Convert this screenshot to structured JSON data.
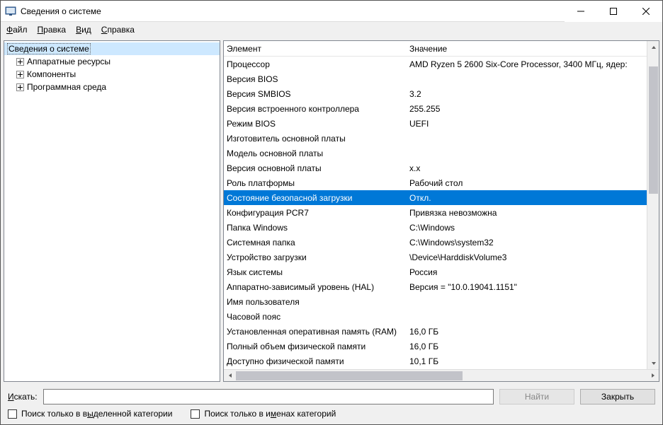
{
  "titlebar": {
    "title": "Сведения о системе"
  },
  "menubar": {
    "file": {
      "html": "<span class='ul'>Ф</span>айл"
    },
    "edit": {
      "html": "<span class='ul'>П</span>равка"
    },
    "view": {
      "html": "<span class='ul'>В</span>ид"
    },
    "help": {
      "html": "<span class='ul'>С</span>правка"
    }
  },
  "tree": {
    "root": "Сведения о системе",
    "items": [
      "Аппаратные ресурсы",
      "Компоненты",
      "Программная среда"
    ]
  },
  "detail": {
    "header_el": "Элемент",
    "header_val": "Значение",
    "rows": [
      {
        "el": "Процессор",
        "val": "AMD Ryzen 5 2600 Six-Core Processor, 3400 МГц, ядер:"
      },
      {
        "el": "Версия BIOS",
        "val": ""
      },
      {
        "el": "Версия SMBIOS",
        "val": "3.2"
      },
      {
        "el": "Версия встроенного контроллера",
        "val": "255.255"
      },
      {
        "el": "Режим BIOS",
        "val": "UEFI"
      },
      {
        "el": "Изготовитель основной платы",
        "val": ""
      },
      {
        "el": "Модель основной платы",
        "val": ""
      },
      {
        "el": "Версия основной платы",
        "val": "x.x"
      },
      {
        "el": "Роль платформы",
        "val": "Рабочий стол"
      },
      {
        "el": "Состояние безопасной загрузки",
        "val": "Откл.",
        "selected": true
      },
      {
        "el": "Конфигурация PCR7",
        "val": "Привязка невозможна"
      },
      {
        "el": "Папка Windows",
        "val": "C:\\Windows"
      },
      {
        "el": "Системная папка",
        "val": "C:\\Windows\\system32"
      },
      {
        "el": "Устройство загрузки",
        "val": "\\Device\\HarddiskVolume3"
      },
      {
        "el": "Язык системы",
        "val": "Россия"
      },
      {
        "el": "Аппаратно-зависимый уровень (HAL)",
        "val": "Версия = \"10.0.19041.1151\""
      },
      {
        "el": "Имя пользователя",
        "val": ""
      },
      {
        "el": "Часовой пояс",
        "val": ""
      },
      {
        "el": "Установленная оперативная память (RAM)",
        "val": "16,0 ГБ"
      },
      {
        "el": "Полный объем физической памяти",
        "val": "16,0 ГБ"
      },
      {
        "el": "Доступно физической памяти",
        "val": "10,1 ГБ"
      }
    ]
  },
  "bottom": {
    "search_label_html": "<span class='ul'>И</span>скать:",
    "find_label": "Найти",
    "close_label": "Закрыть",
    "chk1_html": "Поиск только в в<span class='ul'>ы</span>деленной категории",
    "chk2_html": "Поиск только в и<span class='ul'>м</span>енах категорий"
  }
}
